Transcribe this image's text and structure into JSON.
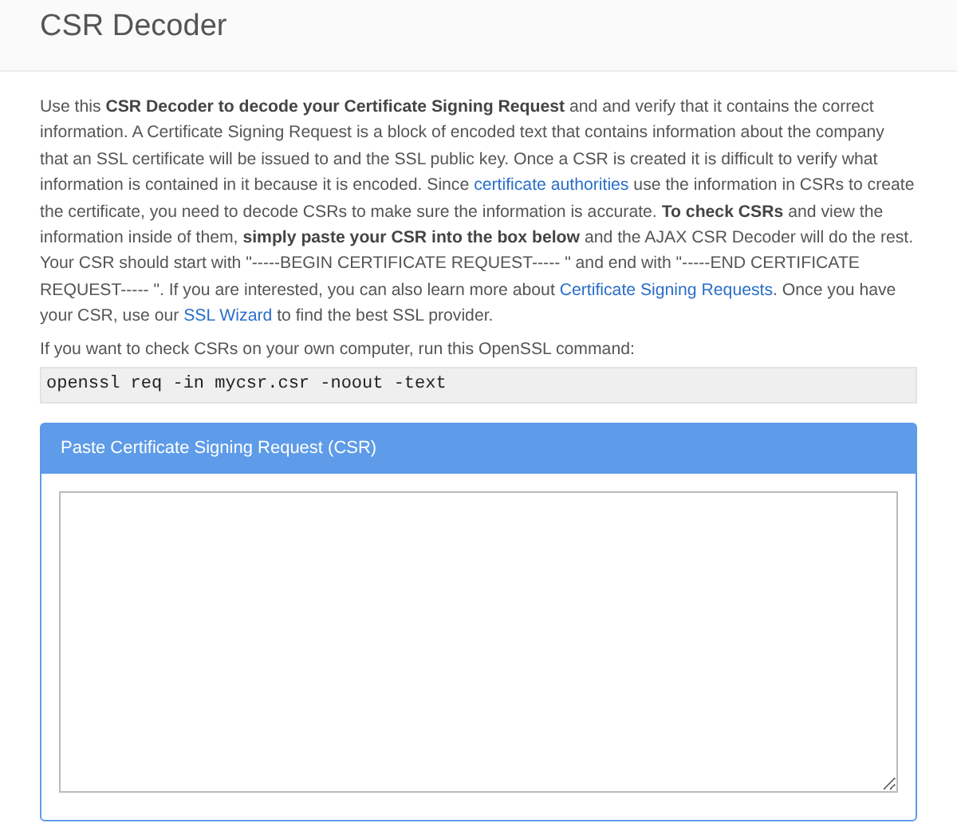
{
  "header": {
    "title": "CSR Decoder"
  },
  "intro": [
    {
      "kind": "text",
      "text": "Use this **CSR Decoder to decode your Certificate Signing Request** and and verify that it contains the correct information. A Certificate Signing Request is a block of encoded text that contains information about the company that an SSL certificate will be issued to and the SSL public key. Once a CSR is created it is difficult to verify what information is contained in it because it is encoded. Since "
    },
    {
      "kind": "link",
      "text": "certificate authorities"
    },
    {
      "kind": "text",
      "text": " use the information in CSRs to create the certificate, you need to decode CSRs to make sure the information is accurate. **To check CSRs** and view the information inside of them, **simply paste your CSR into the box below** and the AJAX CSR Decoder will do the rest. Your CSR should start with \"-----BEGIN CERTIFICATE REQUEST----- \" and end with \"-----END CERTIFICATE REQUEST----- \". If you are interested, you can also learn more about "
    },
    {
      "kind": "link",
      "text": "Certificate Signing Requests"
    },
    {
      "kind": "text",
      "text": ". Once you have your CSR, use our "
    },
    {
      "kind": "link",
      "text": "SSL Wizard"
    },
    {
      "kind": "text",
      "text": " to find the best SSL provider."
    }
  ],
  "command_intro": "If you want to check CSRs on your own computer, run this OpenSSL command:",
  "command": "openssl req -in mycsr.csr -noout -text",
  "panel": {
    "title": "Paste Certificate Signing Request (CSR)"
  }
}
